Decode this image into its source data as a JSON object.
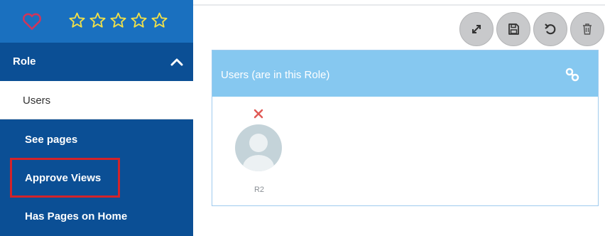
{
  "favorite": {
    "heart_icon": "heart-outline-icon",
    "heart_color": "#d1355a",
    "star_icon": "star-outline-icon",
    "star_color": "#f0e04a",
    "rating_max": 5,
    "rating_value": 0
  },
  "sidebar": {
    "section_title": "Role",
    "section_chevron": "chevron-up-icon",
    "items": [
      {
        "label": "Users",
        "active": true
      },
      {
        "label": "See pages",
        "active": false
      },
      {
        "label": "Approve Views",
        "active": false,
        "highlighted": true
      },
      {
        "label": "Has Pages on Home",
        "active": false
      }
    ]
  },
  "toolbar": {
    "buttons": [
      {
        "icon": "expand-icon"
      },
      {
        "icon": "save-icon"
      },
      {
        "icon": "undo-icon"
      },
      {
        "icon": "trash-icon"
      }
    ]
  },
  "panel": {
    "title": "Users (are in this Role)",
    "header_icon": "link-icon",
    "header_color": "#86c8f0",
    "users": [
      {
        "name": "R2",
        "remove_icon": "close-icon",
        "remove_color": "#e05a56",
        "avatar_icon": "avatar-placeholder-icon"
      }
    ]
  },
  "colors": {
    "sidebar": "#0b4f95",
    "sidebar_top": "#1a70bf",
    "highlight": "#d2232a"
  }
}
